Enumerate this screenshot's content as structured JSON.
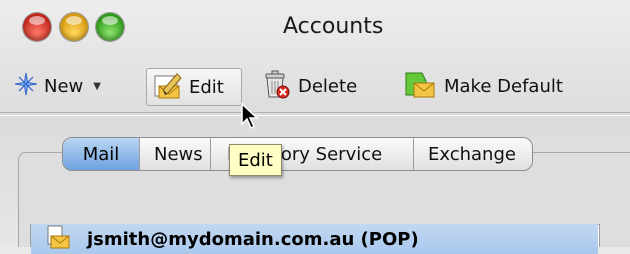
{
  "window": {
    "title": "Accounts"
  },
  "toolbar": {
    "new_label": "New",
    "edit_label": "Edit",
    "delete_label": "Delete",
    "make_default_label": "Make Default"
  },
  "tabs": [
    {
      "label": "Mail",
      "selected": true
    },
    {
      "label": "News"
    },
    {
      "label": "Directory Service"
    },
    {
      "label": "Exchange"
    }
  ],
  "tooltip": {
    "text": "Edit"
  },
  "accounts": [
    {
      "label": "jsmith@mydomain.com.au (POP)",
      "selected": true
    }
  ],
  "icons": {
    "new": "star-sparkle-icon",
    "edit": "pencil-envelope-icon",
    "delete": "trash-can-icon",
    "make_default": "green-check-envelope-icon",
    "account": "mail-account-icon"
  },
  "colors": {
    "selection": "#a9c8ec",
    "tooltip_bg": "#ffffc6"
  }
}
